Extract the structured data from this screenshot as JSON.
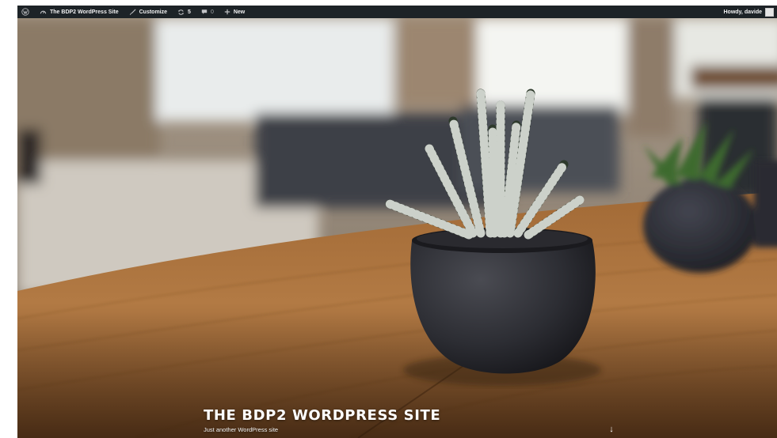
{
  "admin_bar": {
    "site_name": "The BDP2 WordPress Site",
    "customize": "Customize",
    "updates_count": "5",
    "comments_count": "0",
    "new": "New",
    "greeting": "Howdy, davide"
  },
  "hero": {
    "site_title": "THE BDP2 WORDPRESS SITE",
    "tagline": "Just another WordPress site",
    "scroll_glyph": "↓"
  }
}
